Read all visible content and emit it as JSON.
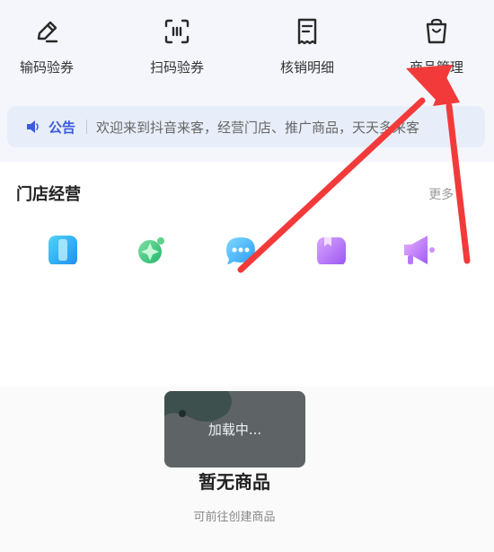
{
  "quick_actions": [
    {
      "label": "输码验券",
      "icon": "pencil-edit-icon"
    },
    {
      "label": "扫码验券",
      "icon": "scan-code-icon"
    },
    {
      "label": "核销明细",
      "icon": "receipt-icon"
    },
    {
      "label": "商品管理",
      "icon": "shopping-bag-icon"
    }
  ],
  "notice": {
    "label": "公告",
    "text": "欢迎来到抖音来客，经营门店、推广商品，天天多来客",
    "icon": "speaker-icon"
  },
  "store_section": {
    "title": "门店经营",
    "more": "更多"
  },
  "toast": {
    "text": "加载中..."
  },
  "empty_state": {
    "title": "暂无商品",
    "subtitle": "可前往创建商品"
  },
  "colors": {
    "accent": "#3b5bdb",
    "annotation_arrow": "#f23a3a"
  }
}
